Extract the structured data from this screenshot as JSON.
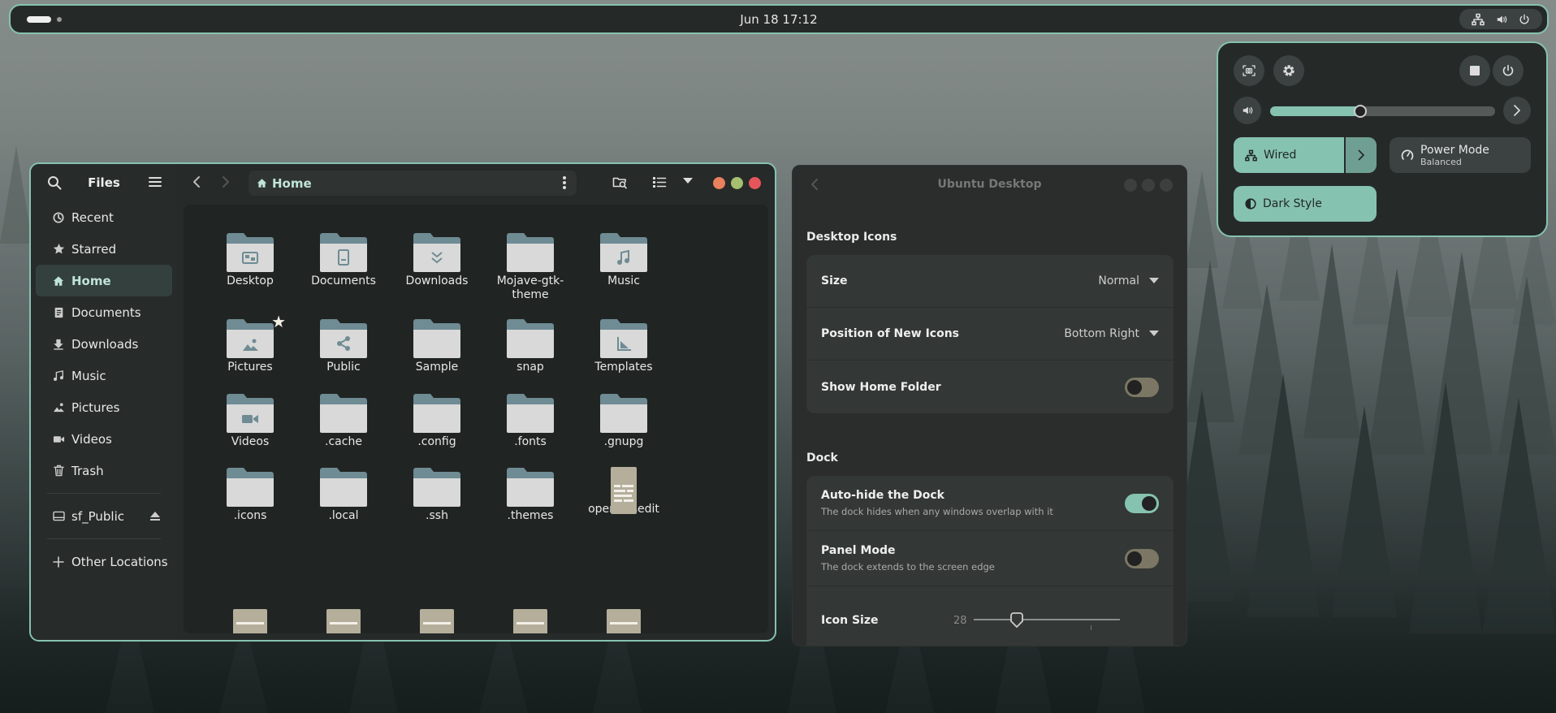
{
  "topbar": {
    "clock": "Jun 18  17:12"
  },
  "files": {
    "title": "Files",
    "path": "Home",
    "sidebar": [
      {
        "label": "Recent",
        "icon": "clock-icon"
      },
      {
        "label": "Starred",
        "icon": "star-icon"
      },
      {
        "label": "Home",
        "icon": "home-icon",
        "active": true
      },
      {
        "label": "Documents",
        "icon": "document-icon"
      },
      {
        "label": "Downloads",
        "icon": "download-icon"
      },
      {
        "label": "Music",
        "icon": "music-icon"
      },
      {
        "label": "Pictures",
        "icon": "picture-icon"
      },
      {
        "label": "Videos",
        "icon": "video-icon"
      },
      {
        "label": "Trash",
        "icon": "trash-icon"
      }
    ],
    "device": "sf_Public",
    "other": "Other Locations",
    "items": [
      [
        "Desktop",
        "Documents",
        "Downloads",
        "Mojave-gtk-theme",
        "Music"
      ],
      [
        "Pictures",
        "Public",
        "Sample",
        "snap",
        "Templates"
      ],
      [
        "Videos",
        ".cache",
        ".config",
        ".fonts",
        ".gnupg"
      ],
      [
        ".icons",
        ".local",
        ".ssh",
        ".themes",
        "open-msedit"
      ]
    ]
  },
  "settings": {
    "title": "Ubuntu Desktop",
    "section1": "Desktop Icons",
    "size_label": "Size",
    "size_value": "Normal",
    "position_label": "Position of New Icons",
    "position_value": "Bottom Right",
    "home_folder_label": "Show Home Folder",
    "home_folder_on": false,
    "section2": "Dock",
    "autohide_label": "Auto-hide the Dock",
    "autohide_desc": "The dock hides when any windows overlap with it",
    "autohide_on": true,
    "panel_label": "Panel Mode",
    "panel_desc": "The dock extends to the screen edge",
    "panel_on": false,
    "icon_size_label": "Icon Size",
    "icon_size_value": "28"
  },
  "quick_settings": {
    "volume_percent": 40,
    "wired_label": "Wired",
    "power_mode_label": "Power Mode",
    "power_mode_value": "Balanced",
    "dark_style_label": "Dark Style"
  },
  "colors": {
    "accent": "#86c2b0",
    "folder_body": "#d8d9d8",
    "folder_tab": "#6f8b94"
  }
}
